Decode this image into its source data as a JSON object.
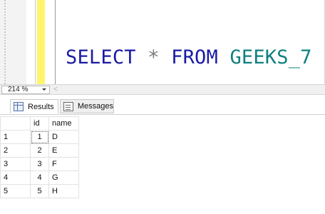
{
  "editor": {
    "query": {
      "kw_select": "SELECT",
      "star": "*",
      "kw_from": "FROM",
      "table": "GEEKS_7"
    }
  },
  "zoom": {
    "level": "214 %",
    "scroll_left_glyph": "<"
  },
  "tabs": [
    {
      "label": "Results",
      "icon": "results-grid-icon",
      "selected": true
    },
    {
      "label": "Messages",
      "icon": "messages-icon",
      "selected": false
    }
  ],
  "grid": {
    "columns": [
      "id",
      "name"
    ],
    "rows": [
      {
        "row_num": "1",
        "id": "1",
        "name": "D"
      },
      {
        "row_num": "2",
        "id": "2",
        "name": "E"
      },
      {
        "row_num": "3",
        "id": "3",
        "name": "F"
      },
      {
        "row_num": "4",
        "id": "4",
        "name": "G"
      },
      {
        "row_num": "5",
        "id": "5",
        "name": "H"
      }
    ]
  },
  "colors": {
    "keyword": "#1a1aa6",
    "table_name": "#0f7f7f",
    "change_bar": "#fff56b"
  }
}
